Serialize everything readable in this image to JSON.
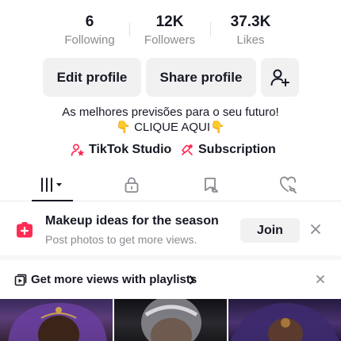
{
  "stats": [
    {
      "value": "6",
      "label": "Following"
    },
    {
      "value": "12K",
      "label": "Followers"
    },
    {
      "value": "37.3K",
      "label": "Likes"
    }
  ],
  "buttons": {
    "edit_profile": "Edit profile",
    "share_profile": "Share profile"
  },
  "bio": {
    "line1": "As melhores previsões para o seu futuro!",
    "line2": "👇 CLIQUE AQUI👇"
  },
  "links": {
    "studio": "TikTok Studio",
    "subscription": "Subscription"
  },
  "tabs": [
    "videos-grid",
    "private",
    "favorites",
    "liked"
  ],
  "promo": {
    "title": "Makeup ideas for the season",
    "subtitle": "Post photos to get more views.",
    "join_label": "Join"
  },
  "playlist_banner": {
    "label": "Get more views with playlists"
  },
  "colors": {
    "accent": "#fe2c55",
    "text": "#161823",
    "muted": "#8a8b91",
    "button_bg": "#f1f1f2"
  }
}
